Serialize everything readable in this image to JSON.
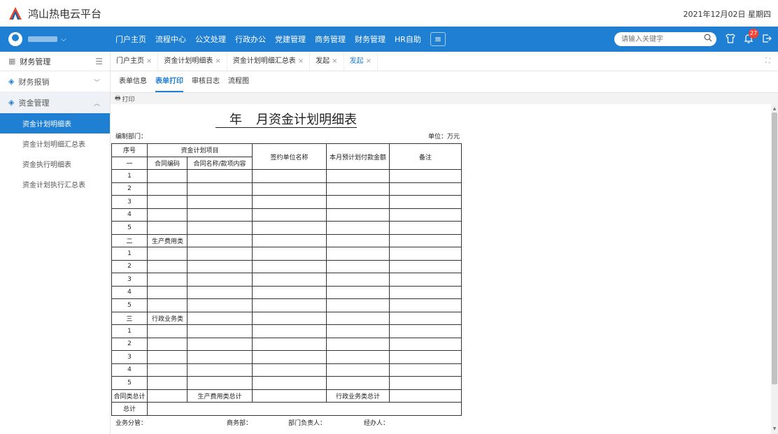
{
  "app": {
    "title": "鸿山热电云平台",
    "date": "2021年12月02日 星期四"
  },
  "nav": {
    "menu": [
      "门户主页",
      "流程中心",
      "公文处理",
      "行政办公",
      "党建管理",
      "商务管理",
      "财务管理",
      "HR自助"
    ],
    "search_placeholder": "请输入关键字",
    "notification_count": "27"
  },
  "sidebar": {
    "header": "财务管理",
    "groups": [
      {
        "label": "财务报销",
        "open": false,
        "items": []
      },
      {
        "label": "资金管理",
        "open": true,
        "items": [
          "资金计划明细表",
          "资金计划明细汇总表",
          "资金执行明细表",
          "资金计划执行汇总表"
        ]
      }
    ],
    "active_item": "资金计划明细表"
  },
  "tabs": [
    "门户主页",
    "资金计划明细表",
    "资金计划明细汇总表",
    "发起",
    "发起"
  ],
  "active_tab_index": 4,
  "subtabs": [
    "表单信息",
    "表单打印",
    "审核日志",
    "流程图"
  ],
  "active_subtab_index": 1,
  "print_label": "打印",
  "doc": {
    "title_year": "年",
    "title_rest": "月资金计划明细表",
    "dept_label": "编制部门：",
    "unit_label": "单位：万元",
    "headers": {
      "seq": "序号",
      "project": "资金计划项目",
      "contract_no": "合同编码",
      "contract_name": "合同名称/款项内容",
      "signer": "签约单位名称",
      "amount": "本月预计划付款金额",
      "remark": "备注"
    },
    "rows": [
      {
        "seq": "一",
        "label": ""
      },
      {
        "seq": "1",
        "label": ""
      },
      {
        "seq": "2",
        "label": ""
      },
      {
        "seq": "3",
        "label": ""
      },
      {
        "seq": "4",
        "label": ""
      },
      {
        "seq": "5",
        "label": ""
      },
      {
        "seq": "二",
        "label": "生产费用类"
      },
      {
        "seq": "1",
        "label": ""
      },
      {
        "seq": "2",
        "label": ""
      },
      {
        "seq": "3",
        "label": ""
      },
      {
        "seq": "4",
        "label": ""
      },
      {
        "seq": "5",
        "label": ""
      },
      {
        "seq": "三",
        "label": "行政业务类"
      },
      {
        "seq": "1",
        "label": ""
      },
      {
        "seq": "2",
        "label": ""
      },
      {
        "seq": "3",
        "label": ""
      },
      {
        "seq": "4",
        "label": ""
      },
      {
        "seq": "5",
        "label": ""
      }
    ],
    "summary": {
      "contract_total": "合同类总计",
      "production_total": "生产费用类总计",
      "admin_total": "行政业务类总计",
      "grand_total": "总计"
    },
    "footer": {
      "business_head": "业务分管：",
      "commerce": "商务部：",
      "dept_head": "部门负责人：",
      "handler": "经办人："
    }
  }
}
